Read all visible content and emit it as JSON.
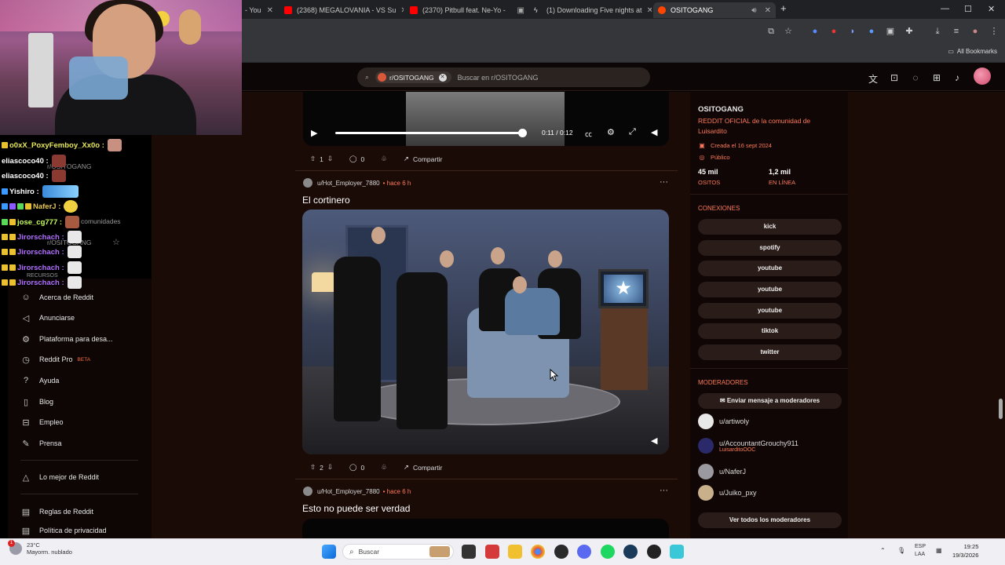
{
  "browser": {
    "tabs": [
      {
        "label": "- You",
        "color": "#ff0000"
      },
      {
        "label": "(2368) MEGALOVANIA - VS Su",
        "color": "#ff0000"
      },
      {
        "label": "(2370) Pitbull feat. Ne-Yo -",
        "color": "#ff0000"
      },
      {
        "label": "(1) Downloading Five nights at",
        "color": "#dddddd"
      },
      {
        "label": "OSITOGANG",
        "color": "#ff4500"
      }
    ],
    "new_tab": "+",
    "bookmarks_all": "All Bookmarks"
  },
  "header": {
    "community_chip": "r/OSITOGANG",
    "search_placeholder": "Buscar en r/OSITOGANG"
  },
  "left_nav": {
    "items": [
      {
        "icon": "reddit-icon",
        "label": "Acerca de Reddit"
      },
      {
        "icon": "megaphone-icon",
        "label": "Anunciarse"
      },
      {
        "icon": "developer-icon",
        "label": "Plataforma para desa..."
      },
      {
        "icon": "pro-icon",
        "label": "Reddit Pro",
        "badge": "BETA"
      },
      {
        "icon": "help-icon",
        "label": "Ayuda"
      },
      {
        "icon": "blog-icon",
        "label": "Blog"
      },
      {
        "icon": "briefcase-icon",
        "label": "Empleo"
      },
      {
        "icon": "press-icon",
        "label": "Prensa"
      }
    ],
    "best_of": "Lo mejor de Reddit",
    "rules": "Reglas de Reddit",
    "privacy": "Política de privacidad"
  },
  "feed": {
    "video1": {
      "time": "0:11 / 0:12",
      "progress": 0.92
    },
    "post1_actions": {
      "upvotes": "1",
      "comments": "0",
      "share": "Compartir"
    },
    "post2": {
      "user": "u/Hot_Employer_7880",
      "time": "• hace 6 h",
      "title": "El cortinero",
      "upvotes": "2",
      "comments": "0",
      "share": "Compartir"
    },
    "post3": {
      "user": "u/Hot_Employer_7880",
      "time": "• hace 6 h",
      "title": "Esto no puede ser verdad"
    },
    "more": "···"
  },
  "community": {
    "name": "OSITOGANG",
    "description": "REDDIT OFICIAL de la comunidad de Luisardito",
    "created": "Creada el 16 sept 2024",
    "visibility": "Público",
    "members_value": "45 mil",
    "members_label": "OSITOS",
    "online_value": "1,2 mil",
    "online_label": "EN LÍNEA",
    "connections_title": "CONEXIONES",
    "connections": [
      "kick",
      "spotify",
      "youtube",
      "youtube",
      "youtube",
      "tiktok",
      "twitter"
    ],
    "moderators_title": "MODERADORES",
    "message_mods": "Enviar mensaje a moderadores",
    "moderators": [
      {
        "name": "u/artiwoly",
        "sub": ""
      },
      {
        "name": "u/AccountantGrouchy911",
        "sub": "LuisarditoOOC"
      },
      {
        "name": "u/NaferJ",
        "sub": ""
      },
      {
        "name": "u/Juiko_pxy",
        "sub": ""
      }
    ],
    "view_all_mods": "Ver todos los moderadores"
  },
  "stream_chat": [
    {
      "user": "o0xX_PoxyFemboy_Xx0o :",
      "color": "#e8e85a"
    },
    {
      "user": "eliascoco40 :",
      "color": "#ffffff"
    },
    {
      "user": "eliascoco40 :",
      "color": "#ffffff"
    },
    {
      "user": "Yishiro :",
      "color": "#ffffff"
    },
    {
      "user": "NaferJ :",
      "color": "#e8c850"
    },
    {
      "user": "jose_cg777 :",
      "color": "#c8ff5a"
    },
    {
      "user": "Jirorschach :",
      "color": "#b070ff"
    },
    {
      "user": "Jirorschach :",
      "color": "#b070ff"
    },
    {
      "user": "Jirorschach :",
      "color": "#b070ff"
    },
    {
      "user": "Jirorschach :",
      "color": "#b070ff"
    }
  ],
  "ghost_text": {
    "line1": "r/OSITOGANG",
    "line2": "comunidades",
    "line3": "r/OSITOGANG",
    "line4": "RECURSOS"
  },
  "taskbar": {
    "temp": "23°C",
    "weather": "Mayorm. nublado",
    "weather_badge": "1",
    "search": "Buscar",
    "lang1": "ESP",
    "lang2": "LAA",
    "time": "19:25",
    "date": "19/3/2026"
  },
  "colors": {
    "accent": "#ff7a5a",
    "page_bg": "#1a0b07",
    "card_bg": "#2a1c18"
  }
}
